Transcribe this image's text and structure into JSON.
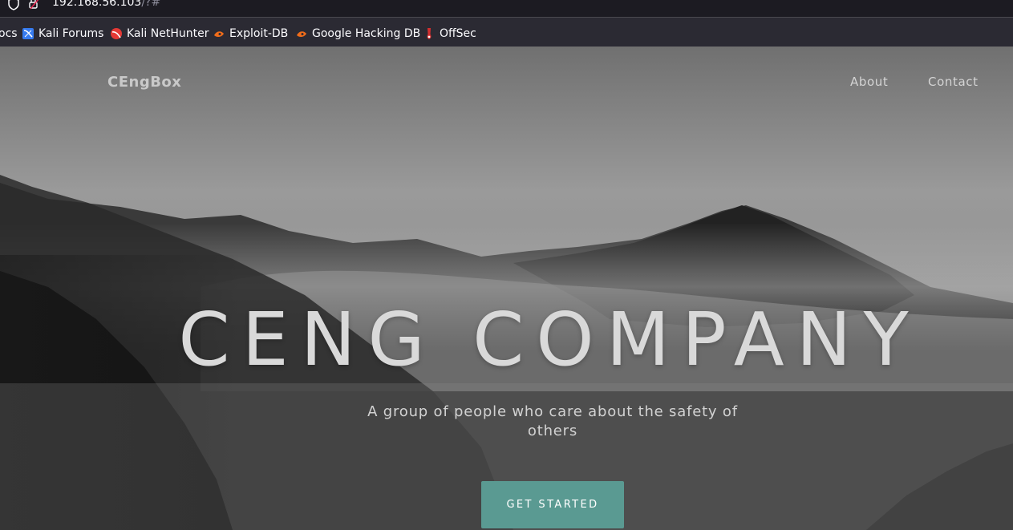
{
  "browser": {
    "url_host": "192.168.56.103",
    "url_rest": "/?#",
    "bookmarks": [
      {
        "label": "ocs",
        "icon": "docs-icon"
      },
      {
        "label": "Kali Forums",
        "icon": "kali-forums-icon"
      },
      {
        "label": "Kali NetHunter",
        "icon": "kali-nethunter-icon"
      },
      {
        "label": "Exploit-DB",
        "icon": "exploit-db-icon"
      },
      {
        "label": "Google Hacking DB",
        "icon": "google-hacking-db-icon"
      },
      {
        "label": "OffSec",
        "icon": "offsec-icon"
      }
    ]
  },
  "site": {
    "brand": "CEngBox",
    "nav": {
      "about": "About",
      "contact": "Contact"
    },
    "hero": {
      "title": "CENG COMPANY",
      "subtitle": "A group of people who care about the safety of others",
      "cta": "GET STARTED"
    }
  },
  "colors": {
    "cta_background": "#5a9a92",
    "browser_chrome": "#2b2a33",
    "url_field": "#1c1b22"
  }
}
